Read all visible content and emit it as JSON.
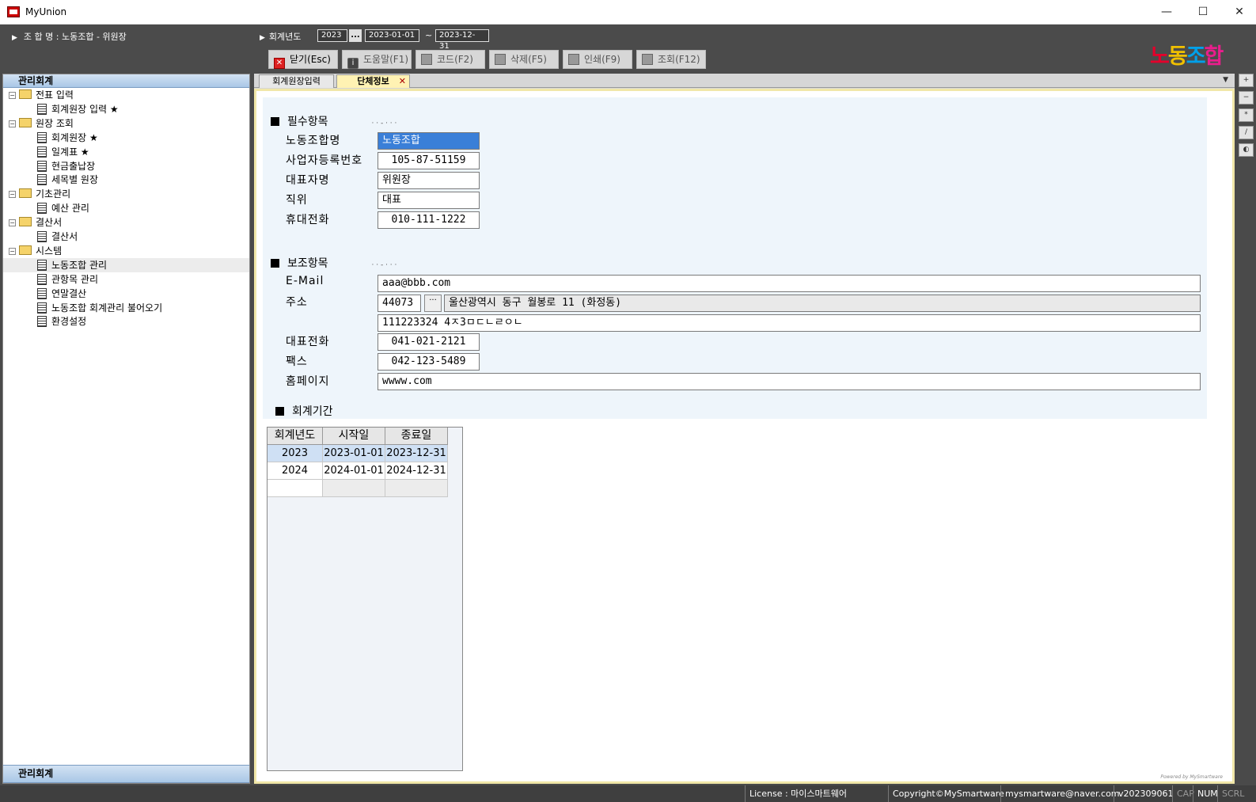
{
  "window": {
    "title": "MyUnion",
    "minimize": "—",
    "maximize": "☐",
    "close": "✕"
  },
  "header": {
    "union_line": "조 합 명 : 노동조합 - 위원장",
    "fiscal_label": "회계년도",
    "fiscal_year": "2023",
    "fiscal_dots": "...",
    "start_date": "2023-01-01",
    "tilde": "~",
    "end_date": "2023-12-31",
    "logo": [
      "노",
      "동",
      "조",
      "합"
    ]
  },
  "toolbar": {
    "close_label": "닫기(Esc)",
    "help_label": "도움말(F1)",
    "code_label": "코드(F2)",
    "delete_label": "삭제(F5)",
    "print_label": "인쇄(F9)",
    "query_label": "조회(F12)"
  },
  "sidebar": {
    "title": "관리회계",
    "footer_title": "관리회계",
    "tree": [
      {
        "type": "folder",
        "label": "전표 입력",
        "level": 0
      },
      {
        "type": "doc",
        "label": "회계원장 입력 ★",
        "level": 1
      },
      {
        "type": "folder",
        "label": "원장 조회",
        "level": 0
      },
      {
        "type": "doc",
        "label": "회계원장 ★",
        "level": 1
      },
      {
        "type": "doc",
        "label": "일계표 ★",
        "level": 1
      },
      {
        "type": "doc",
        "label": "현금출납장",
        "level": 1
      },
      {
        "type": "doc",
        "label": "세목별 원장",
        "level": 1
      },
      {
        "type": "folder",
        "label": "기초관리",
        "level": 0
      },
      {
        "type": "doc",
        "label": "예산 관리",
        "level": 1
      },
      {
        "type": "folder",
        "label": "결산서",
        "level": 0
      },
      {
        "type": "doc",
        "label": "결산서",
        "level": 1
      },
      {
        "type": "folder",
        "label": "시스템",
        "level": 0
      },
      {
        "type": "doc",
        "label": "노동조합 관리",
        "level": 1,
        "selected": true
      },
      {
        "type": "doc",
        "label": "관항목 관리",
        "level": 1
      },
      {
        "type": "doc",
        "label": "연말결산",
        "level": 1
      },
      {
        "type": "doc",
        "label": "노동조합 회계관리 불어오기",
        "level": 1
      },
      {
        "type": "doc",
        "label": "환경설정",
        "level": 1
      }
    ]
  },
  "tabs": {
    "ledger_input": "회계원장입력",
    "org_info": "단체정보",
    "close_x": "✕",
    "dropdown": "▼"
  },
  "form": {
    "required_title": "필수항목",
    "required_dots": "· · - · · ·",
    "union_name_label": "노동조합명",
    "union_name": "노동조합",
    "biz_no_label": "사업자등록번호",
    "biz_no": "105-87-51159",
    "rep_name_label": "대표자명",
    "rep_name": "위원장",
    "position_label": "직위",
    "position": "대표",
    "mobile_label": "휴대전화",
    "mobile": "010-111-1222",
    "optional_title": "보조항목",
    "optional_dots": "· · - · · ·",
    "email_label": "E-Mail",
    "email": "aaa@bbb.com",
    "address_label": "주소",
    "zip": "44073",
    "zip_dots": "···",
    "address1": "울산광역시 동구 월봉로 11 (화정동)",
    "address2": "111223324 4ㅈ3ㅁㄷㄴㄹㅇㄴ",
    "rep_phone_label": "대표전화",
    "rep_phone": "041-021-2121",
    "fax_label": "팩스",
    "fax": "042-123-5489",
    "homepage_label": "홈페이지",
    "homepage": "wwww.com",
    "period_title": "회계기간"
  },
  "period_table": {
    "headers": [
      "회계년도",
      "시작일",
      "종료일"
    ],
    "rows": [
      [
        "2023",
        "2023-01-01",
        "2023-12-31"
      ],
      [
        "2024",
        "2024-01-01",
        "2024-12-31"
      ]
    ]
  },
  "powered_by": "Powered by MySmartware",
  "right_tools": [
    "+",
    "−",
    "*",
    "/",
    "◐"
  ],
  "statusbar": {
    "license": "License : 마이스마트웨어",
    "copyright": "Copyright©MySmartware",
    "email": "mysmartware@naver.com",
    "version": "v202309061",
    "cap": "CAP",
    "num": "NUM",
    "scrl": "SCRL"
  }
}
